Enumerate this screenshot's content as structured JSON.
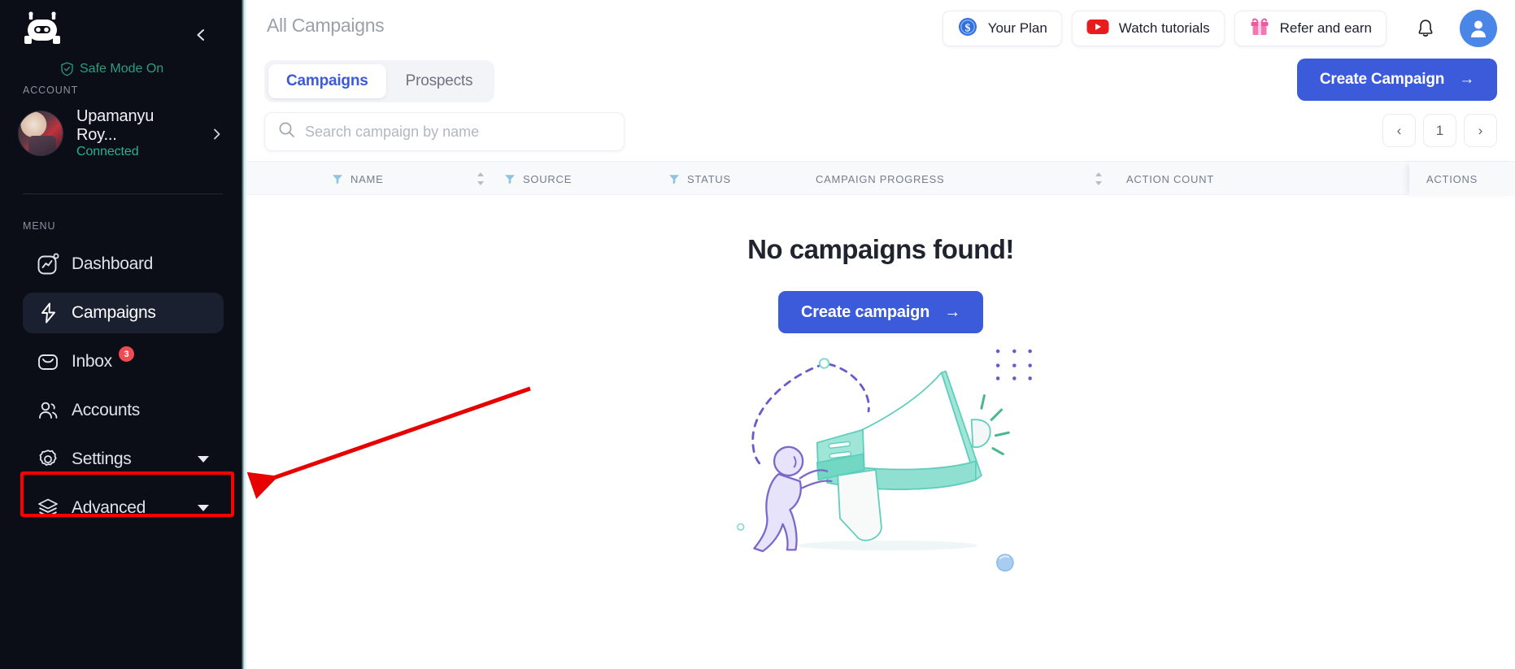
{
  "sidebar": {
    "logo_icon": "robot-logo-icon",
    "collapse_icon": "chevron-left-icon",
    "account_section_label": "ACCOUNT",
    "account": {
      "name": "Upamanyu Roy...",
      "status": "Connected",
      "safe_mode": "Safe Mode On",
      "safe_mode_icon": "shield-check-icon",
      "chevron_icon": "chevron-right-icon",
      "avatar_icon": "avatar"
    },
    "menu_section_label": "MENU",
    "items": [
      {
        "label": "Dashboard",
        "icon": "dashboard-chart-icon",
        "active": false,
        "badge": "",
        "caret": false
      },
      {
        "label": "Campaigns",
        "icon": "lightning-bolt-icon",
        "active": true,
        "badge": "",
        "caret": false
      },
      {
        "label": "Inbox",
        "icon": "envelope-icon",
        "active": false,
        "badge": "3",
        "caret": false
      },
      {
        "label": "Accounts",
        "icon": "users-icon",
        "active": false,
        "badge": "",
        "caret": false
      },
      {
        "label": "Settings",
        "icon": "gear-icon",
        "active": false,
        "badge": "",
        "caret": true
      },
      {
        "label": "Advanced",
        "icon": "layers-icon",
        "active": false,
        "badge": "",
        "caret": true
      }
    ]
  },
  "header": {
    "title": "All Campaigns",
    "buttons": [
      {
        "label": "Your Plan",
        "icon": "dollar-coin-icon"
      },
      {
        "label": "Watch tutorials",
        "icon": "youtube-play-icon"
      },
      {
        "label": "Refer and earn",
        "icon": "gift-icon"
      }
    ],
    "bell_icon": "notification-bell-icon",
    "profile_icon": "user-profile-icon"
  },
  "toolbar": {
    "tabs": [
      {
        "label": "Campaigns",
        "active": true
      },
      {
        "label": "Prospects",
        "active": false
      }
    ],
    "create_campaign_label": "Create Campaign",
    "create_campaign_arrow": "→",
    "search": {
      "placeholder": "Search campaign by name",
      "value": "",
      "icon": "search-icon"
    },
    "pagination": {
      "prev": "‹",
      "page": "1",
      "next": "›"
    }
  },
  "table": {
    "columns": [
      {
        "label": "NAME",
        "filter": true,
        "sortable": true
      },
      {
        "label": "SOURCE",
        "filter": true,
        "sortable": false
      },
      {
        "label": "STATUS",
        "filter": true,
        "sortable": false
      },
      {
        "label": "CAMPAIGN PROGRESS",
        "filter": false,
        "sortable": true
      },
      {
        "label": "ACTION COUNT",
        "filter": false,
        "sortable": false
      },
      {
        "label": "ACTIONS",
        "filter": false,
        "sortable": false
      }
    ],
    "rows": []
  },
  "empty_state": {
    "title": "No campaigns found!",
    "button_label": "Create campaign",
    "button_arrow": "→",
    "illustration": "megaphone-person-illustration"
  },
  "annotation": {
    "highlight_target": "Settings",
    "highlight_color": "#ff0000",
    "arrow_color": "#e60000"
  },
  "colors": {
    "sidebar_bg": "#0b0e17",
    "accent_blue": "#3b5bdb",
    "status_green": "#28b389",
    "badge_red": "#f04b52"
  }
}
